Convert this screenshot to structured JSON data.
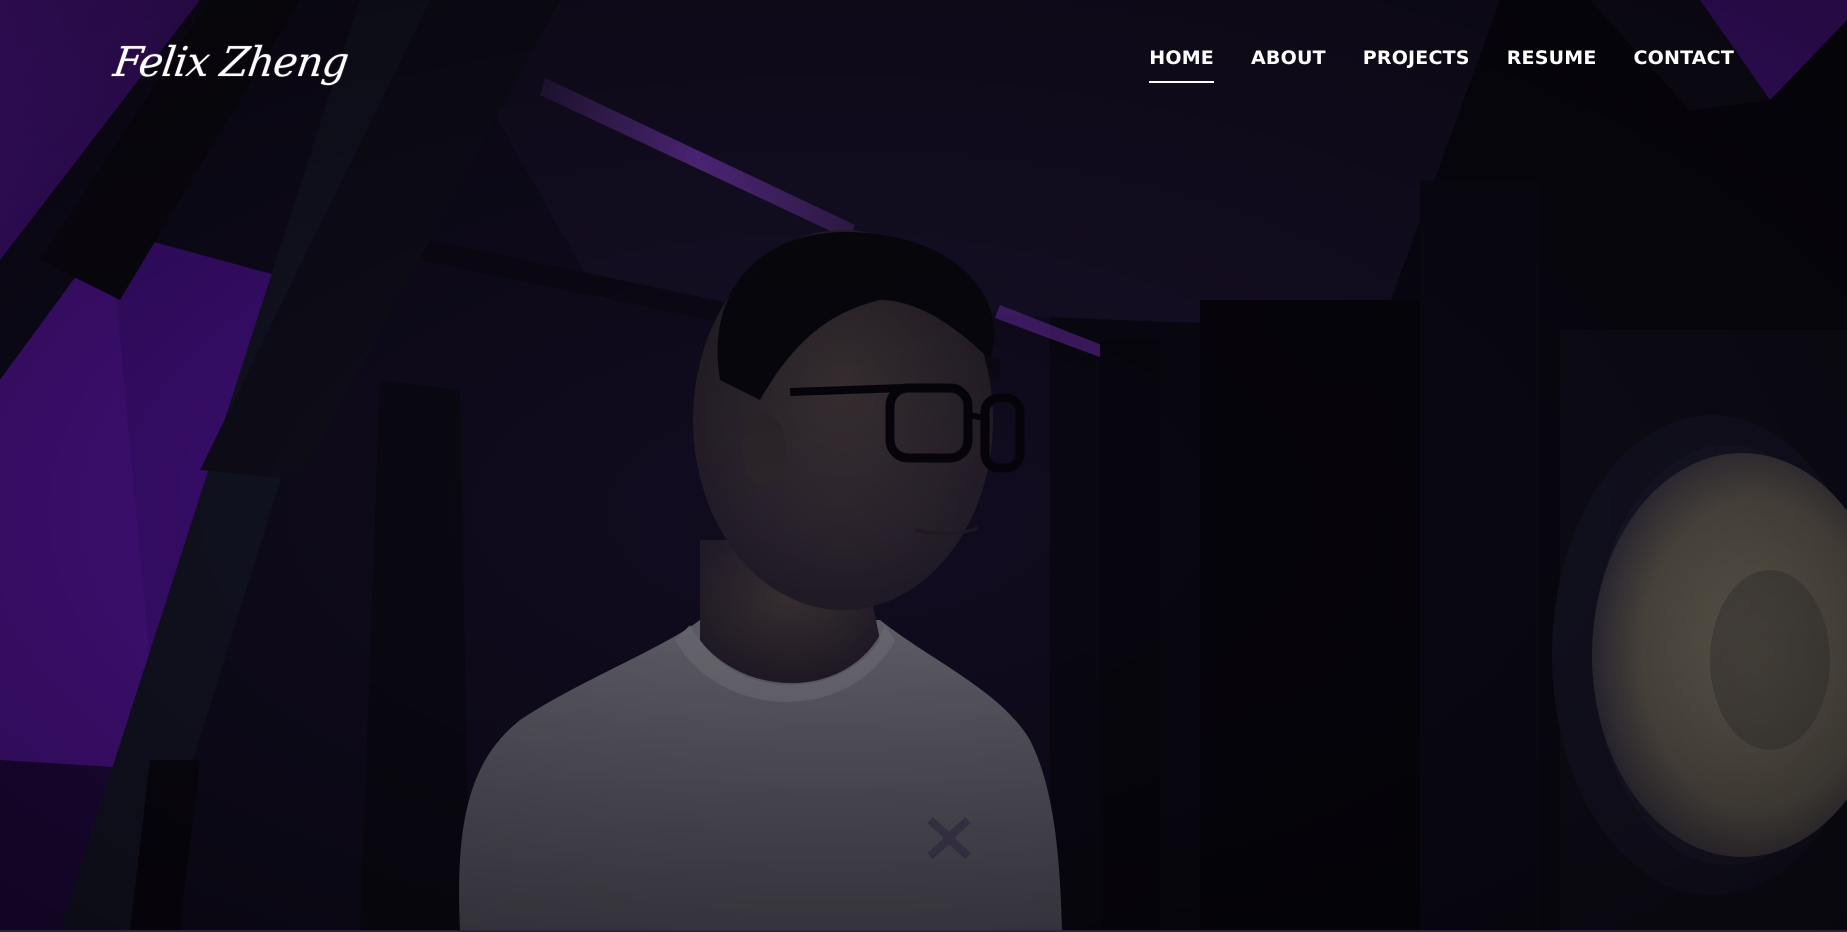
{
  "site": {
    "logo_text": "Felix Zheng"
  },
  "nav": {
    "items": [
      {
        "label": "HOME",
        "active": true
      },
      {
        "label": "ABOUT",
        "active": false
      },
      {
        "label": "PROJECTS",
        "active": false
      },
      {
        "label": "RESUME",
        "active": false
      },
      {
        "label": "CONTACT",
        "active": false
      }
    ]
  },
  "hero": {
    "image_description_icon": "portrait-photo",
    "accent_color": "#7a1fd6",
    "overlay_color": "#0b0816"
  }
}
